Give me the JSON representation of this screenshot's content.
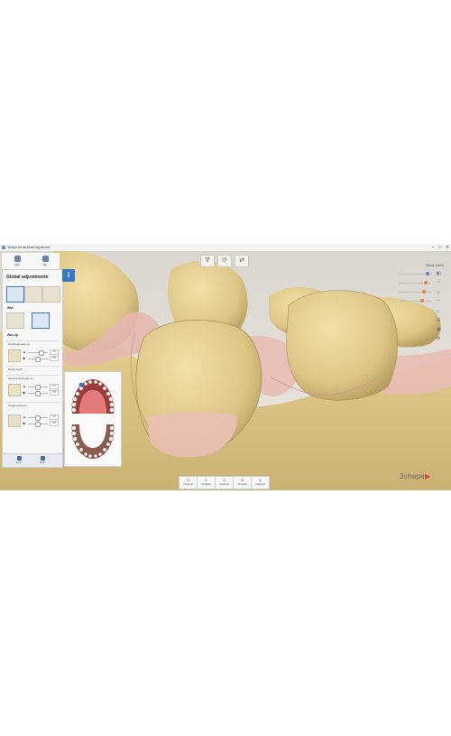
{
  "window": {
    "title": "3Shape Dental Model Adjustment",
    "minimize": "–",
    "maximize": "□",
    "close": "✕"
  },
  "top_tools": [
    {
      "label": "Flap",
      "icon": "tooth-icon"
    },
    {
      "label": "Adj.",
      "icon": "jaw-icon"
    }
  ],
  "view_tools": [
    {
      "name": "occlusion-view-icon",
      "glyph": "ᐁ"
    },
    {
      "name": "rotate-view-icon",
      "glyph": "⟳"
    },
    {
      "name": "swap-jaw-icon",
      "glyph": "⇄"
    }
  ],
  "panel": {
    "title": "Global adjustments",
    "info": "i",
    "section_wax": "Wax",
    "section_waxup": "Wax up",
    "group1": {
      "label": "Overhang wax up",
      "v1": "1.0",
      "v2": "0.5"
    },
    "group2": {
      "label": "Select teeth"
    },
    "group3": {
      "label": "Interproximal wax up",
      "v1": "0.5",
      "v2": "0.5"
    },
    "group4": {
      "label": "Gingiva wax up",
      "v1": "0.5",
      "v2": "0.5"
    },
    "bottom_tabs": [
      "Undo",
      "Redo"
    ]
  },
  "right_panel": {
    "title": "Status Scene"
  },
  "bottom_selector": [
    {
      "num": "0",
      "label": "Original"
    },
    {
      "num": "1",
      "label": "Original"
    },
    {
      "num": "2",
      "label": "Original"
    },
    {
      "num": "3",
      "label": "Original"
    },
    {
      "num": "4",
      "label": "Original"
    }
  ],
  "logo": {
    "text": "3shape",
    "mark": "▶"
  },
  "colors": {
    "tooth": "#e2cc8e",
    "gum": "#e6b8b0",
    "accent": "#3b78c4",
    "brand": "#d94b3c"
  }
}
